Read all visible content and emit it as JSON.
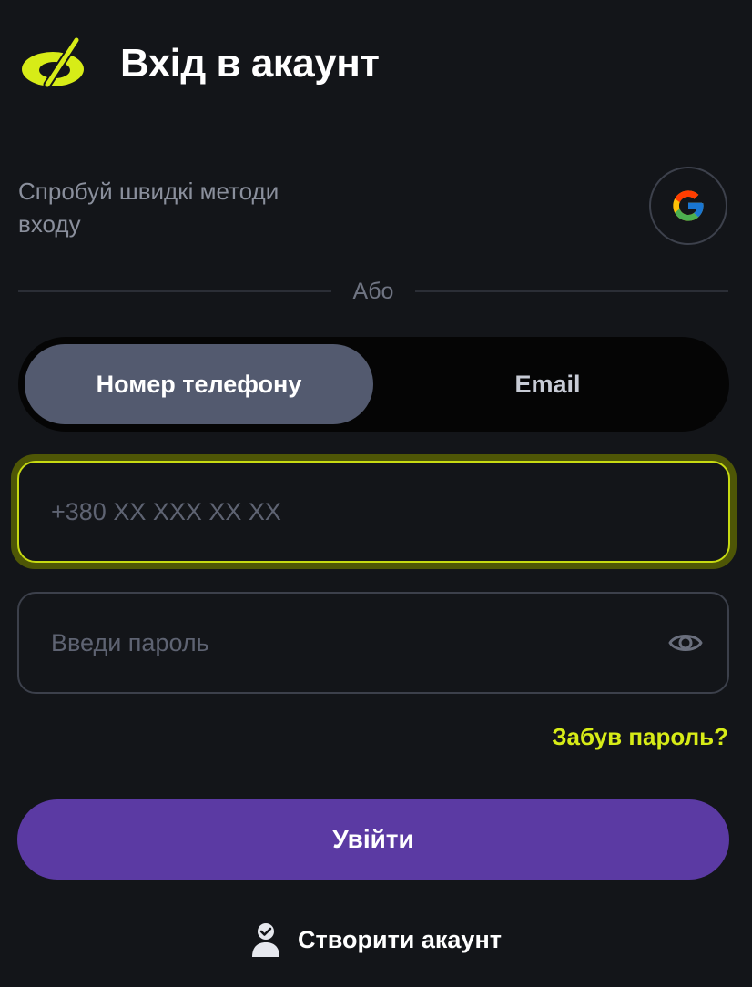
{
  "header": {
    "title": "Вхід в акаунт",
    "logo_icon": "brand-logo-icon",
    "accent_color": "#d7ec17"
  },
  "quick_login": {
    "text": "Спробуй швидкі методи входу",
    "google_icon": "google-icon"
  },
  "divider": {
    "label": "Або"
  },
  "method_toggle": {
    "options": [
      {
        "label": "Номер телефону",
        "selected": true
      },
      {
        "label": "Email",
        "selected": false
      }
    ]
  },
  "phone_field": {
    "value": "",
    "placeholder": "+380 XX XXX XX XX"
  },
  "password_field": {
    "value": "",
    "placeholder": "Введи пароль",
    "toggle_icon": "eye-icon"
  },
  "forgot_password": {
    "label": "Забув пароль?"
  },
  "login_button": {
    "label": "Увійти",
    "color": "#5b3aa3"
  },
  "create_account": {
    "label": "Створити акаунт",
    "icon": "user-check-icon"
  }
}
